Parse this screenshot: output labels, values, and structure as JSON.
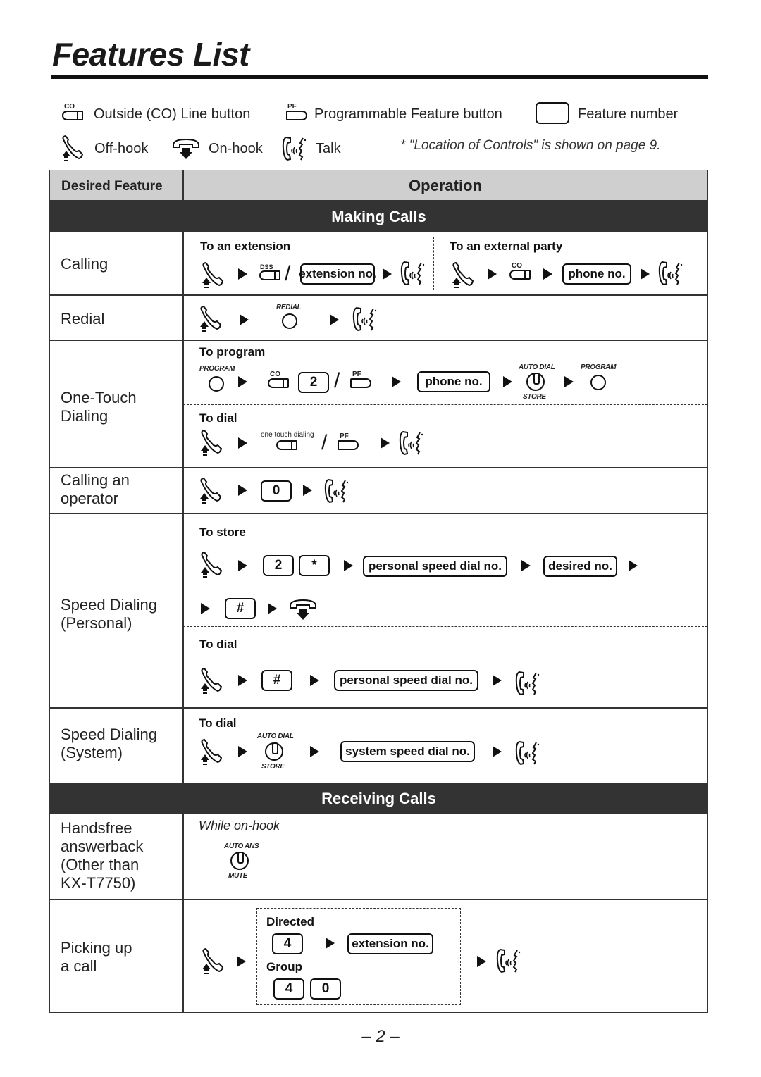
{
  "page": {
    "title": "Features List",
    "page_number": "– 2 –"
  },
  "legend": {
    "co_label": "CO",
    "co_text": "Outside (CO) Line button",
    "pf_label": "PF",
    "pf_text": "Programmable Feature button",
    "feature_number_text": "Feature number",
    "offhook_text": "Off-hook",
    "onhook_text": "On-hook",
    "talk_text": "Talk",
    "note": "* \"Location of Controls\" is shown on page 9."
  },
  "table": {
    "headers": {
      "feature": "Desired Feature",
      "operation": "Operation"
    },
    "sections": {
      "making_calls": "Making Calls",
      "receiving_calls": "Receiving Calls"
    },
    "rows": {
      "calling": {
        "feature": "Calling",
        "to_extension": "To an extension",
        "to_external": "To an external party",
        "dss_label": "DSS",
        "co_label": "CO",
        "extension_box": "extension no.",
        "phone_box": "phone no."
      },
      "redial": {
        "feature": "Redial",
        "redial_label": "REDIAL"
      },
      "one_touch": {
        "feature_line1": "One-Touch",
        "feature_line2": "Dialing",
        "to_program": "To program",
        "program_label": "PROGRAM",
        "co_label": "CO",
        "key_2": "2",
        "pf_label": "PF",
        "phone_box": "phone no.",
        "auto_dial_label": "AUTO DIAL",
        "store_label": "STORE",
        "program_label_2": "PROGRAM",
        "to_dial": "To dial",
        "one_touch_label": "one touch dialing",
        "pf_label_2": "PF"
      },
      "operator": {
        "feature_line1": "Calling an",
        "feature_line2": "operator",
        "key_0": "0"
      },
      "speed_personal": {
        "feature_line1": "Speed Dialing",
        "feature_line2": "(Personal)",
        "to_store": "To store",
        "key_2": "2",
        "key_star": "*",
        "personal_box": "personal speed dial no.",
        "desired_box": "desired no.",
        "key_hash": "#",
        "to_dial": "To dial",
        "key_hash_2": "#",
        "personal_box_2": "personal speed dial no."
      },
      "speed_system": {
        "feature_line1": "Speed Dialing",
        "feature_line2": "(System)",
        "to_dial": "To dial",
        "auto_dial_label": "AUTO DIAL",
        "store_label": "STORE",
        "system_box": "system speed dial no."
      },
      "handsfree": {
        "feature_line1": "Handsfree",
        "feature_line2": "answerback",
        "feature_line3": "(Other than",
        "feature_line4": "KX-T7750)",
        "while_onhook": "While on-hook",
        "auto_ans_label": "AUTO ANS",
        "mute_label": "MUTE"
      },
      "pickup": {
        "feature_line1": "Picking up",
        "feature_line2": "a call",
        "directed": "Directed",
        "key_4": "4",
        "extension_box": "extension no.",
        "group": "Group",
        "key_4b": "4",
        "key_0": "0"
      }
    }
  }
}
